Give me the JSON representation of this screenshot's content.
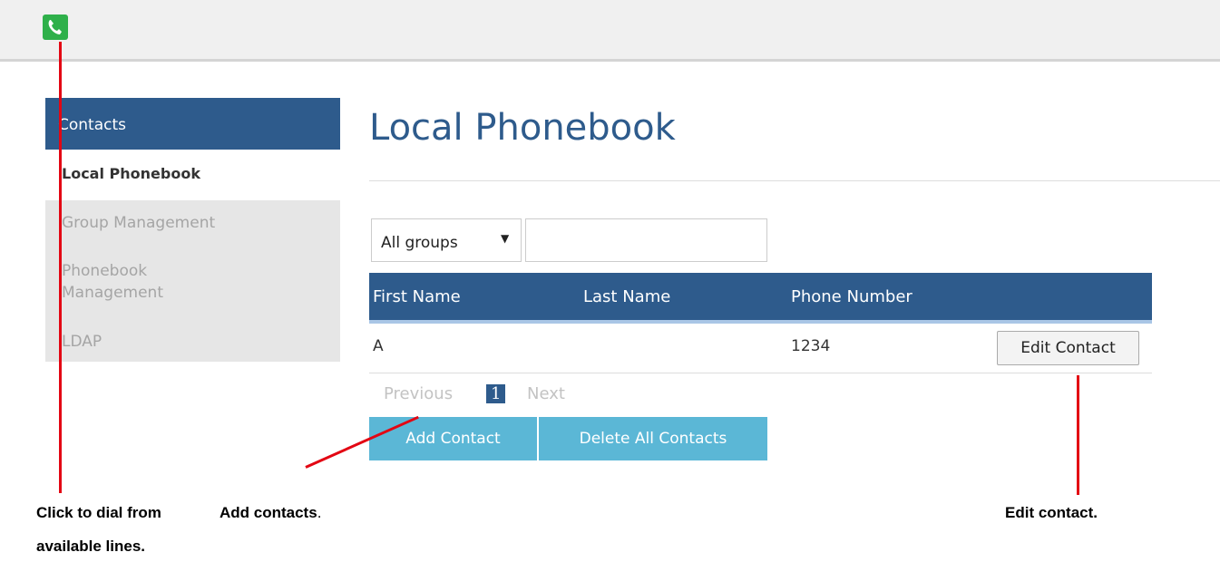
{
  "topbar": {
    "dial_icon": "phone-handset-icon",
    "accent": "#2fb04a"
  },
  "sidebar": {
    "header": "Contacts",
    "items": [
      {
        "label": "Local Phonebook",
        "active": true
      },
      {
        "label": "Group Management",
        "active": false
      },
      {
        "label": "Phonebook",
        "label2": "Management",
        "active": false
      },
      {
        "label": "LDAP",
        "active": false
      }
    ]
  },
  "main": {
    "title": "Local Phonebook",
    "filter": {
      "group_value": "All groups",
      "search_value": ""
    },
    "table": {
      "columns": [
        "First Name",
        "Last Name",
        "Phone Number"
      ],
      "rows": [
        {
          "first_name": "A",
          "last_name": "",
          "phone": "1234",
          "action": "Edit Contact"
        }
      ]
    },
    "pagination": {
      "previous": "Previous",
      "current": "1",
      "next": "Next"
    },
    "actions": {
      "add": "Add Contact",
      "delete_all": "Delete All Contacts"
    }
  },
  "annotations": {
    "dial_1": "Click to dial from",
    "dial_2": "available lines.",
    "add": "Add contacts",
    "add_suffix": ".",
    "edit": "Edit contact."
  },
  "colors": {
    "header_blue": "#2e5b8c",
    "button_cyan": "#5bb7d6",
    "callout_red": "#e30613"
  }
}
